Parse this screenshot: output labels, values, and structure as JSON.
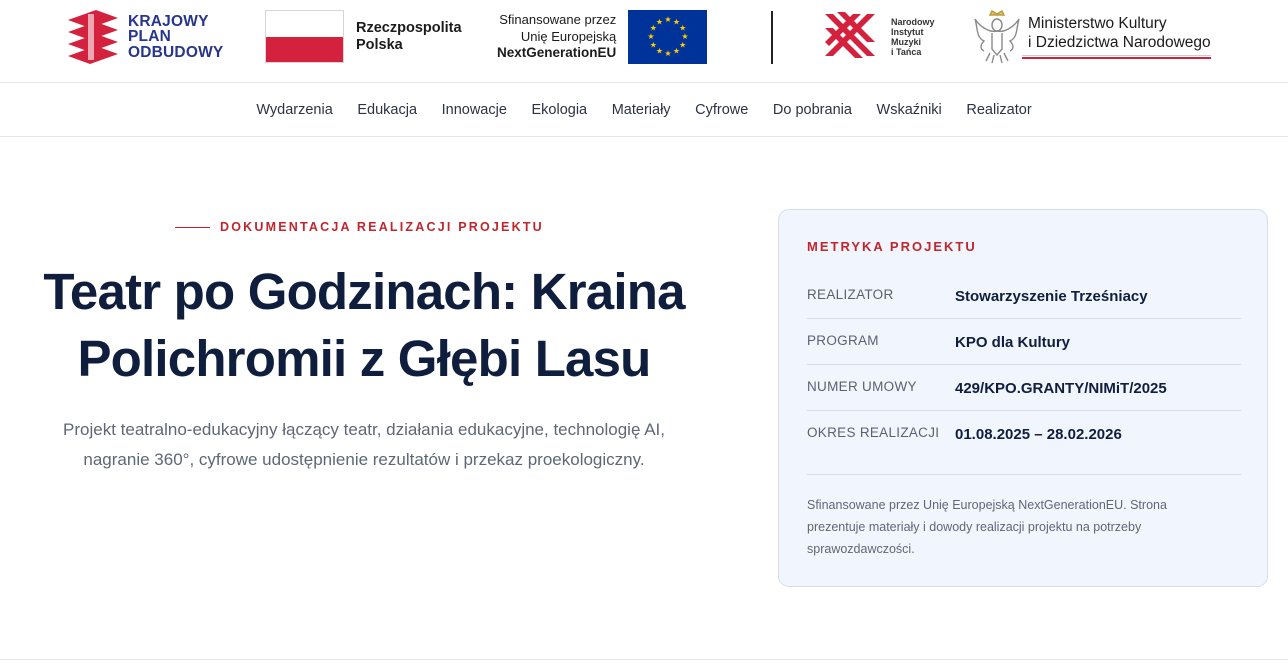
{
  "logos": {
    "kpo": {
      "line1": "KRAJOWY",
      "line2": "PLAN",
      "line3": "ODBUDOWY"
    },
    "rp": {
      "line1": "Rzeczpospolita",
      "line2": "Polska"
    },
    "eu": {
      "line1": "Sfinansowane przez",
      "line2": "Unię Europejską",
      "line3": "NextGenerationEU"
    },
    "nimit": {
      "line1": "Narodowy",
      "line2": "Instytut",
      "line3": "Muzyki",
      "line4": "i Tańca"
    },
    "mkidn": {
      "line1": "Ministerstwo Kultury",
      "line2": "i Dziedzictwa Narodowego"
    }
  },
  "nav": {
    "items": [
      "Wydarzenia",
      "Edukacja",
      "Innowacje",
      "Ekologia",
      "Materiały",
      "Cyfrowe",
      "Do pobrania",
      "Wskaźniki",
      "Realizator"
    ]
  },
  "hero": {
    "eyebrow": "DOKUMENTACJA REALIZACJI PROJEKTU",
    "title_line1": "Teatr po Godzinach: Kraina",
    "title_line2": "Polichromii z Głębi Lasu",
    "description": "Projekt teatralno-edukacyjny łączący teatr, działania edukacyjne, technologię AI, nagranie 360°, cyfrowe udostępnienie rezultatów i przekaz proekologiczny."
  },
  "card": {
    "title": "METRYKA PROJEKTU",
    "rows": [
      {
        "label": "REALIZATOR",
        "value": "Stowarzyszenie Trześniacy"
      },
      {
        "label": "PROGRAM",
        "value": "KPO dla Kultury"
      },
      {
        "label": "NUMER UMOWY",
        "value": "429/KPO.GRANTY/NIMiT/2025"
      },
      {
        "label": "OKRES REALIZACJI",
        "value": "01.08.2025 – 28.02.2026"
      }
    ],
    "note": "Sfinansowane przez Unię Europejską NextGenerationEU. Strona prezentuje materiały i dowody realizacji projektu na potrzeby sprawozdawczości."
  },
  "colors": {
    "accent": "#c0262d",
    "navy": "#0f1e3d",
    "kpo_blue": "#27368c",
    "eu_blue": "#003399",
    "card_bg": "#f1f5fd"
  }
}
